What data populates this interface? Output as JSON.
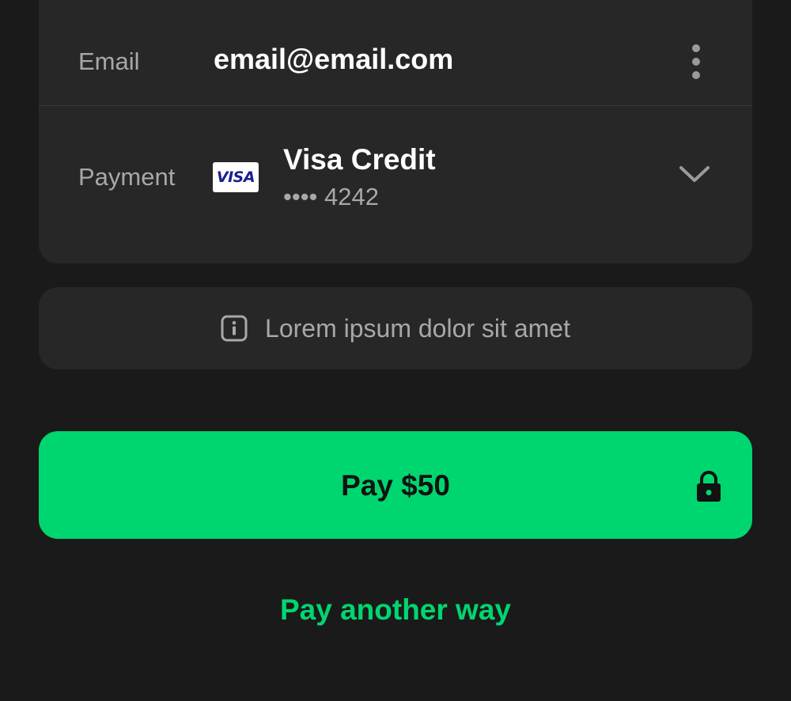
{
  "account": {
    "email_label": "Email",
    "email_value": "email@email.com",
    "more_icon": "more-vertical-icon"
  },
  "payment": {
    "label": "Payment",
    "card_brand": "VISA",
    "card_name": "Visa Credit",
    "card_number": "•••• 4242",
    "expand_icon": "chevron-down-icon"
  },
  "notice": {
    "icon": "info-icon",
    "text": "Lorem ipsum dolor sit amet"
  },
  "actions": {
    "pay_label": "Pay $50",
    "lock_icon": "lock-icon",
    "alternate_label": "Pay another way"
  },
  "colors": {
    "background": "#1a1a1a",
    "card": "#272727",
    "accent": "#00d66f",
    "primary_text": "#ffffff",
    "secondary_text": "#a8a8a8"
  }
}
